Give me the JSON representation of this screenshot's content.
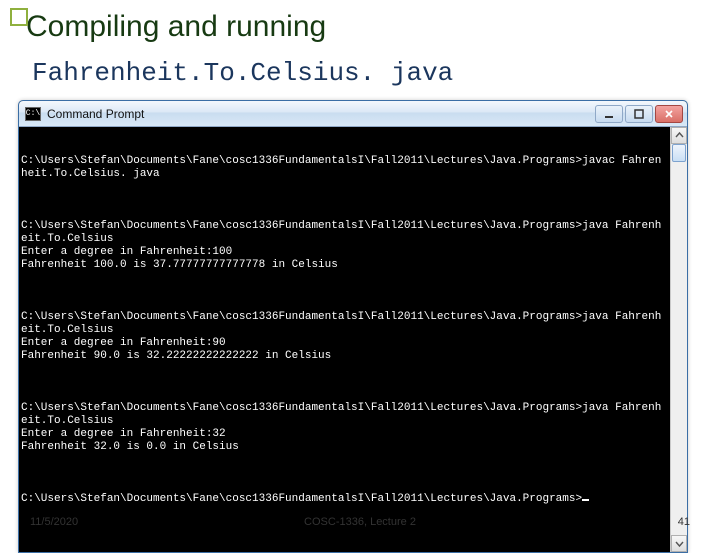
{
  "slide": {
    "title": "Compiling and running",
    "subtitle": "Fahrenheit.To.Celsius. java"
  },
  "window": {
    "icon_text": "C:\\",
    "title": "Command Prompt"
  },
  "terminal": {
    "blocks": [
      "C:\\Users\\Stefan\\Documents\\Fane\\cosc1336FundamentalsI\\Fall2011\\Lectures\\Java.Programs>javac Fahrenheit.To.Celsius. java",
      "C:\\Users\\Stefan\\Documents\\Fane\\cosc1336FundamentalsI\\Fall2011\\Lectures\\Java.Programs>java Fahrenheit.To.Celsius\nEnter a degree in Fahrenheit:100\nFahrenheit 100.0 is 37.77777777777778 in Celsius",
      "C:\\Users\\Stefan\\Documents\\Fane\\cosc1336FundamentalsI\\Fall2011\\Lectures\\Java.Programs>java Fahrenheit.To.Celsius\nEnter a degree in Fahrenheit:90\nFahrenheit 90.0 is 32.22222222222222 in Celsius",
      "C:\\Users\\Stefan\\Documents\\Fane\\cosc1336FundamentalsI\\Fall2011\\Lectures\\Java.Programs>java Fahrenheit.To.Celsius\nEnter a degree in Fahrenheit:32\nFahrenheit 32.0 is 0.0 in Celsius",
      "C:\\Users\\Stefan\\Documents\\Fane\\cosc1336FundamentalsI\\Fall2011\\Lectures\\Java.Programs>"
    ]
  },
  "footer": {
    "date": "11/5/2020",
    "course": "COSC-1336, Lecture 2",
    "page": "41"
  }
}
